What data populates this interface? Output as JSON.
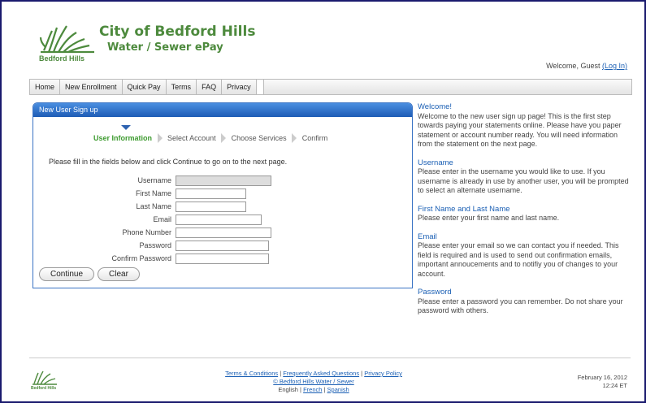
{
  "header": {
    "title_line1": "City of Bedford Hills",
    "title_line2": "Water / Sewer ePay",
    "logo_text": "Bedford Hills",
    "welcome": "Welcome, Guest",
    "login_link": "(Log In)",
    "brand_color": "#4d8a3d"
  },
  "nav": {
    "items": [
      "Home",
      "New Enrollment",
      "Quick Pay",
      "Terms",
      "FAQ",
      "Privacy"
    ]
  },
  "panel": {
    "title": "New User Sign up",
    "steps": [
      "User Information",
      "Select Account",
      "Choose Services",
      "Confirm"
    ],
    "active_step": "User Information",
    "instructions": "Please fill in the fields below and click Continue to go on to the next page.",
    "fields": {
      "username": "Username",
      "first_name": "First Name",
      "last_name": "Last Name",
      "email": "Email",
      "phone": "Phone Number",
      "password": "Password",
      "confirm_password": "Confirm Password"
    },
    "continue_label": "Continue",
    "clear_label": "Clear"
  },
  "help": {
    "welcome_heading": "Welcome!",
    "welcome_text": "Welcome to the new user sign up page! This is the first step towards paying your statements online. Please have you paper statement or account number ready. You will need information from the statement on the next page.",
    "username_heading": "Username",
    "username_text": "Please enter in the username you would like to use. If you username is already in use by another user, you will be prompted to select an alternate username.",
    "name_heading": "First Name and Last Name",
    "name_text": "Please enter your first name and last name.",
    "email_heading": "Email",
    "email_text": "Please enter your email so we can contact you if needed. This field is required and is used to send out confirmation emails, important annoucements and to notifiy you of changes to your account.",
    "password_heading": "Password",
    "password_text": "Please enter a password you can remember. Do not share your password with others."
  },
  "footer": {
    "terms": "Terms & Conditions",
    "faq": "Frequently Asked Questions",
    "privacy": "Privacy Policy",
    "copyright": "© Bedford Hills Water / Sewer",
    "lang_english": "English",
    "lang_french": "French",
    "lang_spanish": "Spanish",
    "logo_text": "Bedford Hills",
    "date": "February 16, 2012",
    "time": "12:24 ET"
  },
  "accent_color": "#1e5cb5"
}
